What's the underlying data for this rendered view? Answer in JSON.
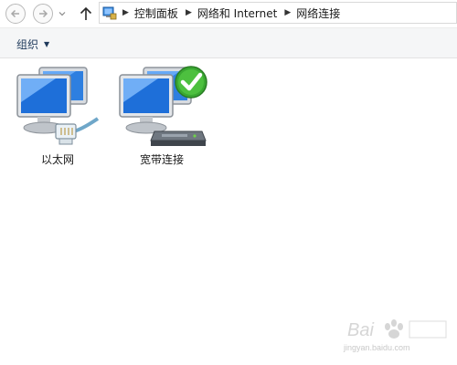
{
  "address_bar": {
    "crumbs": [
      "控制面板",
      "网络和 Internet",
      "网络连接"
    ]
  },
  "command_bar": {
    "organize_label": "组织"
  },
  "items": [
    {
      "label": "以太网",
      "icon": "ethernet-adapter-icon"
    },
    {
      "label": "宽带连接",
      "icon": "broadband-connection-icon",
      "status": "connected-checkmark"
    }
  ],
  "watermark": {
    "site": "jingyan.baidu.com"
  },
  "colors": {
    "check_green": "#3aa832",
    "monitor_blue": "#1e6fd9",
    "command_bar_bg": "#f5f6f7"
  }
}
